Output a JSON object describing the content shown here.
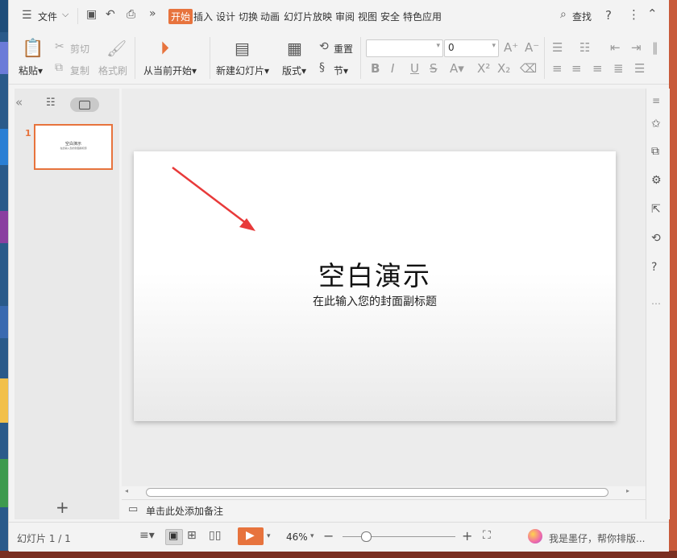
{
  "menu": {
    "file_label": "文件",
    "tabs": [
      "开始",
      "插入",
      "设计",
      "切换",
      "动画",
      "幻灯片放映",
      "审阅",
      "视图",
      "安全",
      "特色应用"
    ],
    "active_tab": "开始",
    "search_label": "查找"
  },
  "ribbon": {
    "paste": "粘贴",
    "cut": "剪切",
    "copy": "复制",
    "format_painter": "格式刷",
    "from_current": "从当前开始",
    "new_slide": "新建幻灯片",
    "layout": "版式",
    "reset": "重置",
    "section": "节",
    "font_name_value": "",
    "font_size_value": "0"
  },
  "slide": {
    "title": "空白演示",
    "subtitle": "在此输入您的封面副标题"
  },
  "thumbnails": {
    "number": "1",
    "title": "空白演示",
    "subtitle": "在此输入您的封面副标题"
  },
  "notes": {
    "placeholder": "单击此处添加备注"
  },
  "status": {
    "slide_counter": "幻灯片 1 / 1",
    "zoom": "46%",
    "assistant": "我是墨仔，帮你排版..."
  },
  "colors": {
    "accent": "#e7733d",
    "arrow": "#e83a3a"
  }
}
